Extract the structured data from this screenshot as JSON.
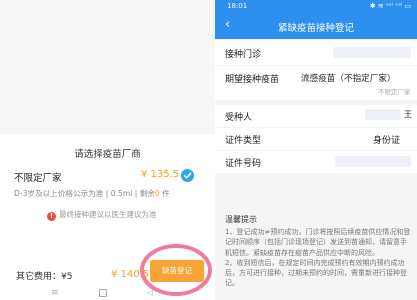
{
  "left": {
    "sheet_title": "请选择疫苗厂商",
    "option": {
      "name": "不限定厂家",
      "price": "¥ 135.5",
      "desc_prefix": "D-3岁及以上价格公示为准 | 0.5ml | 剩余",
      "desc_stock": "0",
      "desc_suffix": " 件"
    },
    "tip": "最终接种建议以医生建议为准",
    "fee_label": "其它费用：¥5",
    "total": "¥ 140.5",
    "register_button": "缺苗登记",
    "colors": {
      "accent": "#f0a020",
      "button": "#f7a335",
      "check": "#2ea6ea",
      "highlight_ring": "#f27a9a"
    }
  },
  "right": {
    "status_time": "18:01",
    "status_icons": "✱ ≋ ᵛᵒˡ ᵛᵒˡ ▭",
    "title": "紧缺疫苗接种登记",
    "clinic_label": "接种门诊",
    "vaccine_label": "期望接种疫苗",
    "vaccine_value": "流感疫苗（不指定厂家）",
    "vaccine_sub": "不限定厂家",
    "person_label": "受种人",
    "person_value": "王",
    "id_type_label": "证件类型",
    "id_type_value": "身份证",
    "id_no_label": "证件号码",
    "notes_title": "温馨提示",
    "notes_1": "1、登记成功≠预约成功，门诊将按照后续疫苗供应情况和登记时间顺序（包括门诊现场登记）发送到苗通知，请留意手机短信。紧缺疫苗存在疫苗产品供应中断的风险。",
    "notes_2": "2、收到短信后，在规定时间内完成预约有效期内预约成功后，方可进行接种，过期未预约的时间，需重新进行接种登记。",
    "colors": {
      "brand": "#2d8ff0"
    }
  }
}
